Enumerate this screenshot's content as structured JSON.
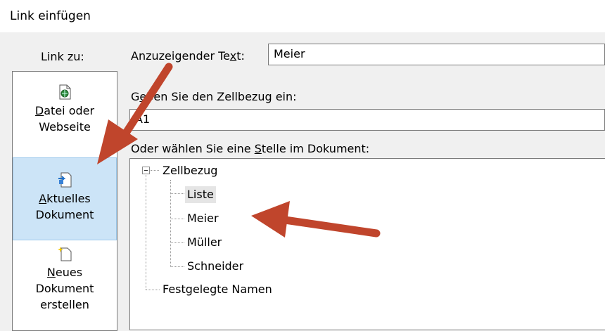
{
  "dialog": {
    "title": "Link einfügen"
  },
  "sidebar": {
    "label": "Link zu:",
    "items": [
      {
        "name": "datei-oder-webseite",
        "line1": "Datei oder",
        "line2": "Webseite",
        "underline": "D",
        "rest": "atei oder",
        "icon": "web-file-icon"
      },
      {
        "name": "aktuelles-dokument",
        "line1": "Aktuelles",
        "line2": "Dokument",
        "underline": "A",
        "rest": "ktuelles",
        "icon": "current-document-icon",
        "selected": true
      },
      {
        "name": "neues-dokument",
        "line1": "Neues",
        "line2": "Dokument",
        "line3": "erstellen",
        "underline": "N",
        "rest": "eues",
        "icon": "new-document-icon"
      }
    ]
  },
  "display_text": {
    "label_pre": "Anzuzeigender Te",
    "label_u": "x",
    "label_post": "t:",
    "value": "Meier"
  },
  "cell_ref": {
    "label_pre": "G",
    "label_u": "e",
    "label_post": "ben Sie den Zellbezug ein:",
    "value": "A1"
  },
  "place": {
    "label_pre": "Oder wählen Sie eine ",
    "label_u": "S",
    "label_post": "telle im Dokument:"
  },
  "tree": {
    "root": "Zellbezug",
    "children": [
      "Liste",
      "Meier",
      "Müller",
      "Schneider"
    ],
    "named": "Festgelegte Namen"
  },
  "colors": {
    "arrow": "#c0452c",
    "selected_bg": "#cce4f7"
  }
}
